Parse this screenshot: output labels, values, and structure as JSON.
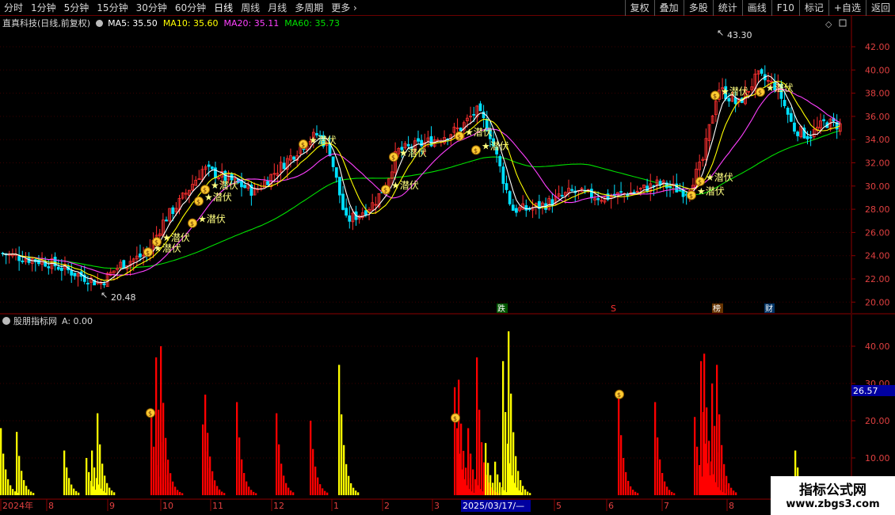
{
  "toolbar": {
    "periods": [
      "分时",
      "1分钟",
      "5分钟",
      "15分钟",
      "30分钟",
      "60分钟",
      "日线",
      "周线",
      "月线",
      "多周期",
      "更多"
    ],
    "active_period": "日线",
    "more_arrow": "›",
    "actions": [
      "复权",
      "叠加",
      "多股",
      "统计",
      "画线",
      "F10",
      "标记",
      "+自选",
      "返回"
    ]
  },
  "main_legend": {
    "title": "直真科技(日线,前复权)",
    "ma5": "MA5: 35.50",
    "ma10": "MA10: 35.60",
    "ma20": "MA20: 35.11",
    "ma60": "MA60: 35.73"
  },
  "indicator_legend": {
    "name": "股朋指标网",
    "value": "A: 0.00"
  },
  "markers": {
    "high_label": "43.30",
    "low_label": "20.48",
    "signal_label": "潜伏",
    "event_die": "跌",
    "event_s": "S",
    "event_bang": "榜",
    "event_cai": "财"
  },
  "axes": {
    "price_ticks": [
      "42.00",
      "40.00",
      "38.00",
      "36.00",
      "34.00",
      "32.00",
      "30.00",
      "28.00",
      "26.00",
      "24.00",
      "22.00",
      "20.00"
    ],
    "indicator_ticks": [
      "40.00",
      "30.00",
      "20.00",
      "10.00"
    ],
    "indicator_current": "26.57",
    "date_ticks": [
      "2024年",
      "8",
      "9",
      "10",
      "11",
      "12",
      "1",
      "2",
      "3",
      "5",
      "6",
      "7",
      "8"
    ],
    "cursor_date": "2025/03/17/—"
  },
  "colors": {
    "ma5": "#ffffff",
    "ma10": "#ffff00",
    "ma20": "#ff40ff",
    "ma60": "#00e000",
    "up": "#ff3030",
    "down": "#00e0ff",
    "bar_red": "#ff0000",
    "bar_yellow": "#ffff00"
  },
  "watermark": {
    "title": "指标公式网",
    "url": "www.zbgs3.com"
  }
}
